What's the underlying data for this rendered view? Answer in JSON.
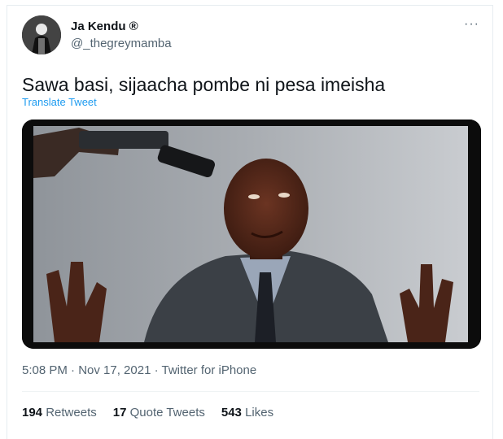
{
  "author": {
    "display_name": "Ja Kendu ®",
    "handle": "@_thegreymamba"
  },
  "menu": {
    "more_icon": "more-horizontal-icon",
    "more_label": "···"
  },
  "tweet": {
    "text": "Sawa basi, sijaacha pombe ni pesa imeisha",
    "translate_label": "Translate Tweet",
    "media_description": "meme-image-man-with-gun-to-head"
  },
  "meta": {
    "timestamp": "5:08 PM · Nov 17, 2021 · Twitter for iPhone"
  },
  "stats": {
    "retweets_count": "194",
    "retweets_label": "Retweets",
    "quotes_count": "17",
    "quotes_label": "Quote Tweets",
    "likes_count": "543",
    "likes_label": "Likes"
  },
  "colors": {
    "link": "#1d9bf0",
    "secondary_text": "#536471",
    "primary_text": "#0f1419"
  }
}
